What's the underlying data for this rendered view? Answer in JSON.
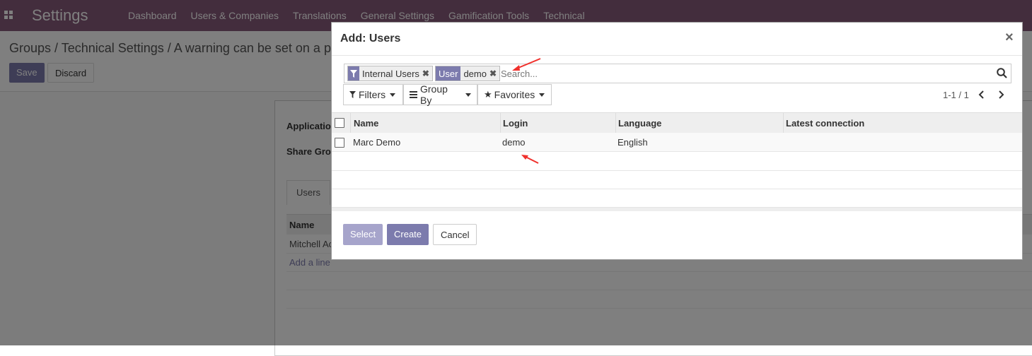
{
  "app": {
    "title": "Settings",
    "menu": [
      "Dashboard",
      "Users & Companies",
      "Translations",
      "General Settings",
      "Gamification Tools",
      "Technical"
    ]
  },
  "background": {
    "breadcrumb": "Groups / Technical Settings / A warning can be set on a p",
    "save_label": "Save",
    "discard_label": "Discard",
    "labels": {
      "application": "Applicatio",
      "share_group": "Share Gro"
    },
    "tab": "Users",
    "table_header": "Name",
    "rows": [
      "Mitchell Ac",
      "Add a line"
    ]
  },
  "dialog": {
    "title": "Add: Users",
    "close": "×",
    "search": {
      "facets": [
        {
          "type": "filter",
          "head_icon": "filter-icon",
          "value": "Internal Users"
        },
        {
          "type": "field",
          "head": "User",
          "value": "demo"
        }
      ],
      "placeholder": "Search..."
    },
    "buttons": {
      "filters": "Filters",
      "group_by": "Group By",
      "favorites": "Favorites"
    },
    "pager": "1-1 / 1",
    "columns": [
      "Name",
      "Login",
      "Language",
      "Latest connection"
    ],
    "rows": [
      {
        "name": "Marc Demo",
        "login": "demo",
        "language": "English",
        "latest_connection": ""
      }
    ],
    "footer": {
      "select": "Select",
      "create": "Create",
      "cancel": "Cancel"
    }
  },
  "colors": {
    "brand": "#875a7b",
    "primary": "#7c7bad",
    "annotation": "#f0302c"
  }
}
